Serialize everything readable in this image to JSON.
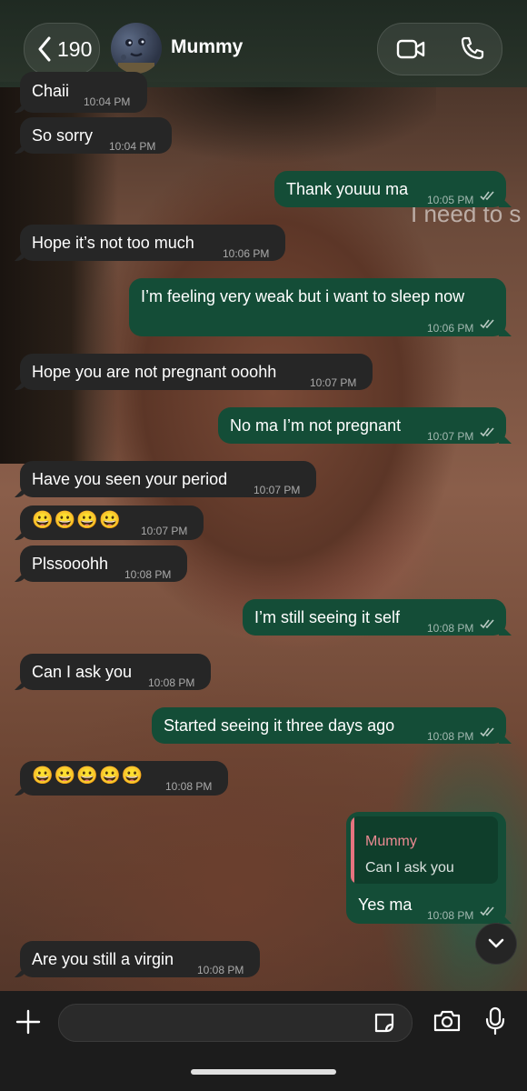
{
  "header": {
    "back_count": "190",
    "contact_name": "Mummy"
  },
  "messages": [
    {
      "dir": "in",
      "text": "Chaii",
      "time": "10:04 PM"
    },
    {
      "dir": "in",
      "text": "So sorry",
      "time": "10:04 PM"
    },
    {
      "dir": "out",
      "text": "Thank youuu ma",
      "time": "10:05 PM",
      "status": "read"
    },
    {
      "dir": "in",
      "text": "Hope it’s not too much",
      "time": "10:06 PM"
    },
    {
      "dir": "out",
      "text": "I’m feeling very weak but i want to sleep now",
      "time": "10:06 PM",
      "status": "read"
    },
    {
      "dir": "in",
      "text": "Hope you are not pregnant ooohh",
      "time": "10:07 PM"
    },
    {
      "dir": "out",
      "text": "No ma I’m not pregnant",
      "time": "10:07 PM",
      "status": "read"
    },
    {
      "dir": "in",
      "text": "Have you seen your period",
      "time": "10:07 PM"
    },
    {
      "dir": "in",
      "text": "😀😀😀😀",
      "time": "10:07 PM"
    },
    {
      "dir": "in",
      "text": "Plssooohh",
      "time": "10:08 PM"
    },
    {
      "dir": "out",
      "text": "I’m still seeing it self",
      "time": "10:08 PM",
      "status": "read"
    },
    {
      "dir": "in",
      "text": "Can I ask you",
      "time": "10:08 PM"
    },
    {
      "dir": "out",
      "text": "Started seeing it three days ago",
      "time": "10:08 PM",
      "status": "read"
    },
    {
      "dir": "in",
      "text": "😀😀😀😀😀",
      "time": "10:08 PM"
    },
    {
      "dir": "out",
      "text": "Yes ma",
      "time": "10:08 PM",
      "status": "read",
      "reply_to": {
        "author": "Mummy",
        "text": "Can I ask you"
      }
    },
    {
      "dir": "in",
      "text": "Are you still a virgin",
      "time": "10:08 PM"
    }
  ],
  "wallpaper_overlay_text": "I need to s",
  "colors": {
    "incoming_bubble": "#262626",
    "outgoing_bubble": "#144d37",
    "quote_accent": "#e5737f"
  },
  "icons": [
    "chevron-left-icon",
    "video-camera-icon",
    "phone-icon",
    "chevron-down-icon",
    "plus-icon",
    "sticker-icon",
    "camera-icon",
    "microphone-icon"
  ]
}
